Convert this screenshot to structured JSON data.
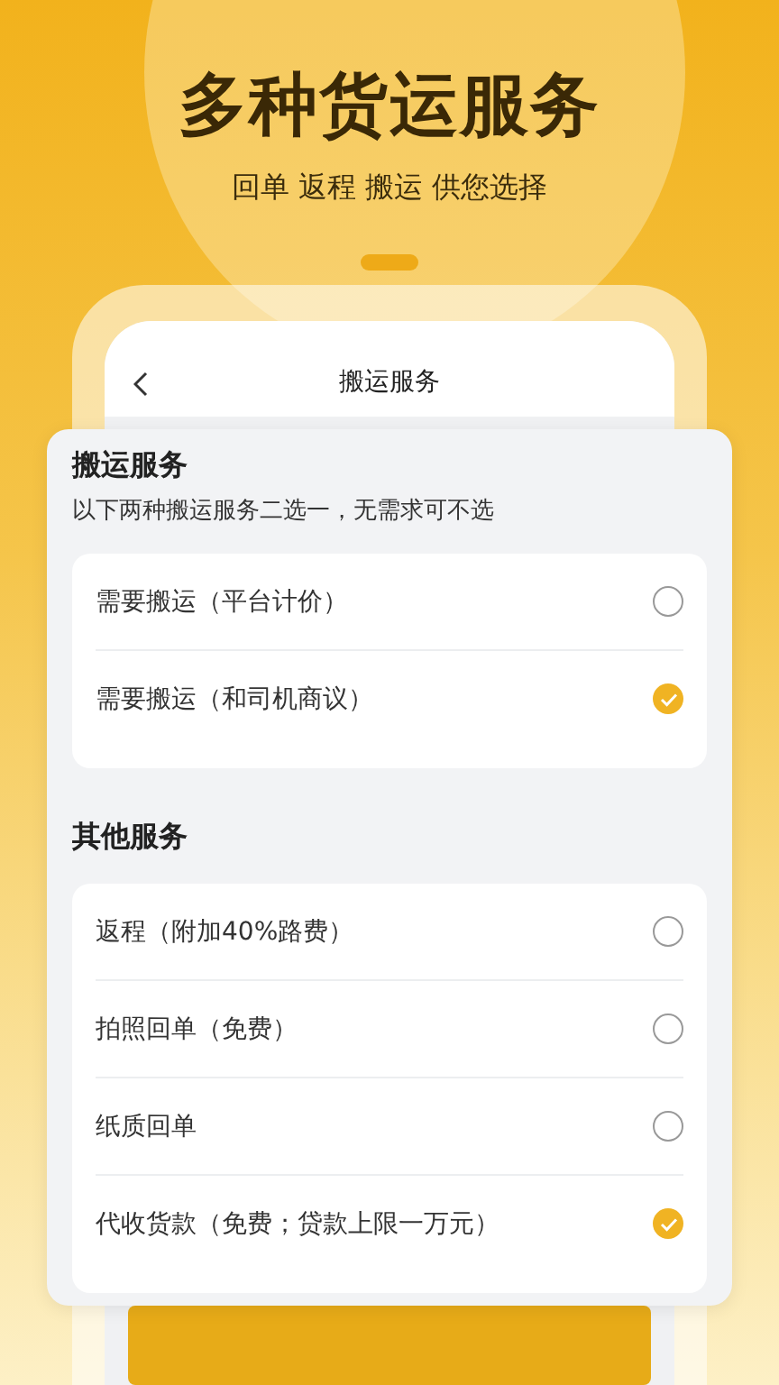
{
  "hero": {
    "title": "多种货运服务",
    "subtitle": "回单 返程 搬运 供您选择"
  },
  "screen": {
    "title": "搬运服务"
  },
  "sections": [
    {
      "title": "搬运服务",
      "note": "以下两种搬运服务二选一，无需求可不选",
      "options": [
        {
          "label": "需要搬运（平台计价）",
          "selected": false
        },
        {
          "label": "需要搬运（和司机商议）",
          "selected": true
        }
      ]
    },
    {
      "title": "其他服务",
      "options": [
        {
          "label": "返程（附加40%路费）",
          "checked": false
        },
        {
          "label": "拍照回单（免费）",
          "checked": false
        },
        {
          "label": "纸质回单",
          "checked": false
        },
        {
          "label": "代收货款（免费；贷款上限一万元）",
          "checked": true
        }
      ]
    }
  ]
}
